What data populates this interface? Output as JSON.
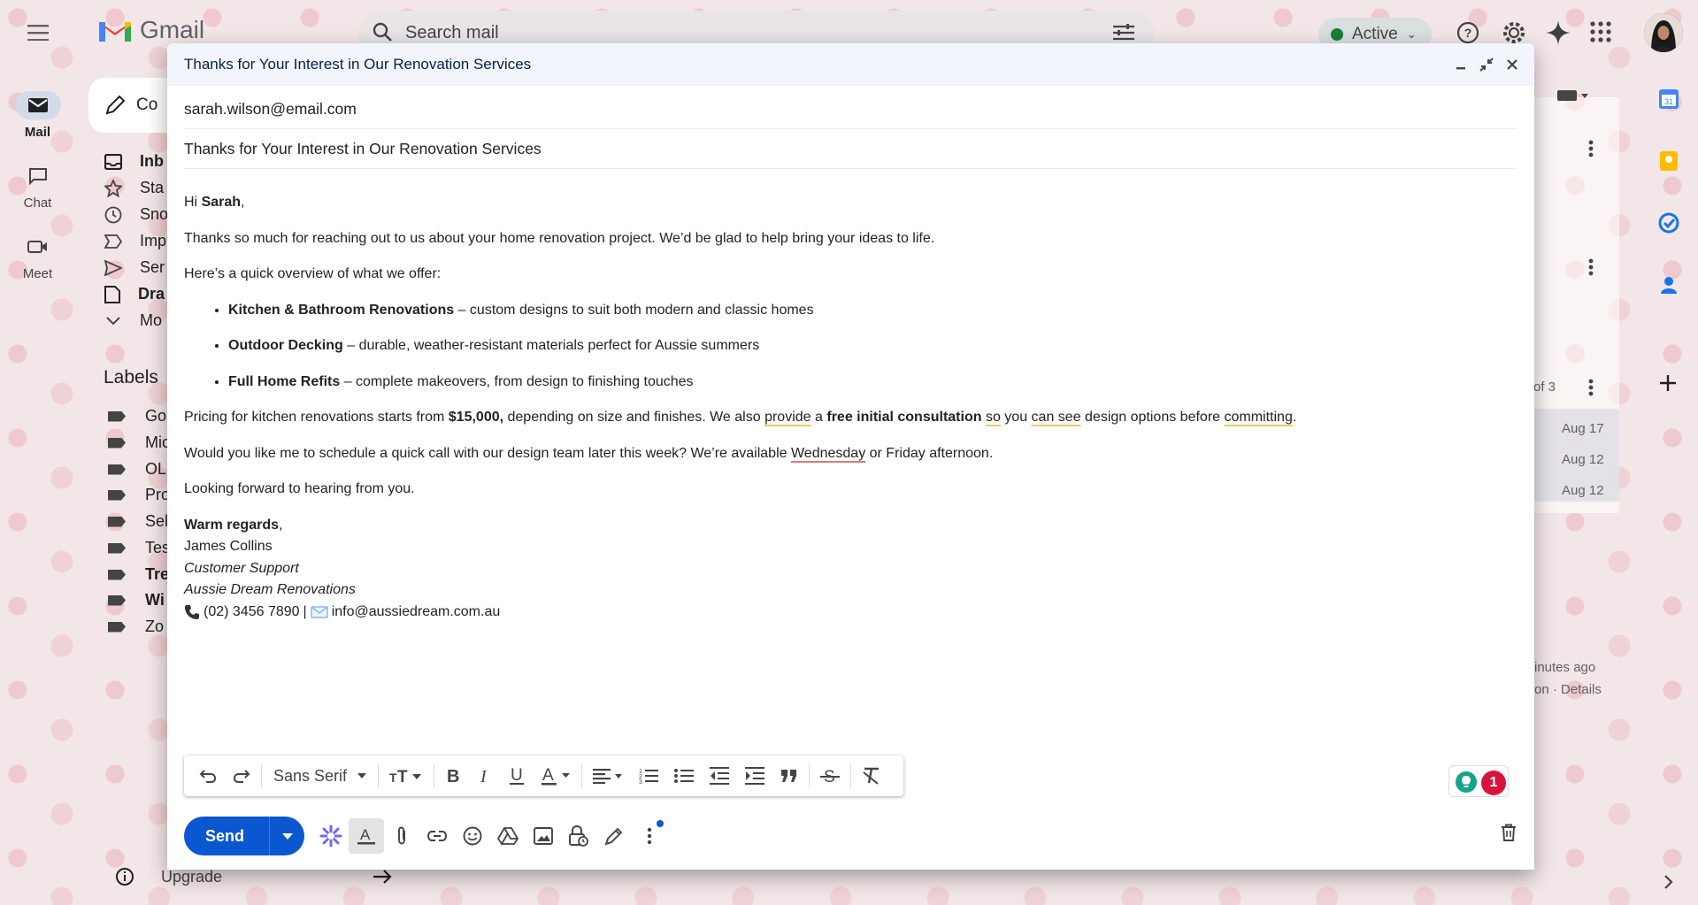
{
  "app": {
    "name": "Gmail"
  },
  "search": {
    "placeholder": "Search mail"
  },
  "status": {
    "label": "Active"
  },
  "rail": [
    {
      "label": "Mail"
    },
    {
      "label": "Chat"
    },
    {
      "label": "Meet"
    }
  ],
  "compose_button": {
    "label": "Co"
  },
  "nav": [
    {
      "label": "Inb",
      "icon": "inbox-icon",
      "bold": true
    },
    {
      "label": "Sta",
      "icon": "star-icon"
    },
    {
      "label": "Sno",
      "icon": "clock-icon"
    },
    {
      "label": "Imp",
      "icon": "important-icon"
    },
    {
      "label": "Ser",
      "icon": "send-icon"
    },
    {
      "label": "Dra",
      "icon": "draft-icon",
      "bold": true
    },
    {
      "label": "Mo",
      "icon": "chevron-down-icon"
    }
  ],
  "labels": {
    "heading": "Labels",
    "items": [
      {
        "label": "Go"
      },
      {
        "label": "Mic"
      },
      {
        "label": "OL"
      },
      {
        "label": "Pro"
      },
      {
        "label": "Sel"
      },
      {
        "label": "Tes"
      },
      {
        "label": "Tre",
        "bold": true
      },
      {
        "label": "Wi",
        "bold": true
      },
      {
        "label": "Zo"
      }
    ]
  },
  "upgrade": {
    "label": "Upgrade"
  },
  "background_list": {
    "page_info": "of 3",
    "dates": [
      "Aug 17",
      "Aug 12",
      "Aug 12"
    ],
    "activity_1": "inutes ago",
    "activity_2": "on · Details"
  },
  "compose": {
    "title": "Thanks for Your Interest in Our Renovation Services",
    "to": "sarah.wilson@email.com",
    "subject": "Thanks for Your Interest in Our Renovation Services",
    "body": {
      "greeting_hi": "Hi",
      "greeting_name": "Sarah",
      "greeting_comma": ",",
      "p1": "Thanks so much for reaching out to us about your home renovation project. We’d be glad to help bring your ideas to life.",
      "p2": "Here’s a quick overview of what we offer:",
      "bullets": [
        {
          "title": "Kitchen & Bathroom Renovations",
          "text": " – custom designs to suit both modern and classic homes"
        },
        {
          "title": "Outdoor Decking",
          "text": " – durable, weather-resistant materials perfect for Aussie summers"
        },
        {
          "title": "Full Home Refits",
          "text": " – complete makeovers, from design to finishing touches"
        }
      ],
      "pricing": {
        "a": "Pricing for kitchen renovations starts from ",
        "b": "$15,000,",
        "c": " depending on size and finishes. We also ",
        "d": "provide",
        "e": " a ",
        "f": "free initial consultation",
        "g": " ",
        "h": "so",
        "i": " you ",
        "j": "can see",
        "k": " design options before ",
        "l": "committing",
        "m": "."
      },
      "schedule": {
        "a": "Would you like me to schedule a quick call with our design team later this week? We’re available ",
        "b": "Wednesday",
        "c": " or Friday afternoon."
      },
      "closing": "Looking forward to hearing from you.",
      "signoff_bold": "Warm regards",
      "signoff_comma": ",",
      "sig_name": "James Collins",
      "sig_role": "Customer Support",
      "sig_company": "Aussie Dream Renovations",
      "sig_phone": "(02) 3456 7890",
      "sig_sep": "|",
      "sig_email": "info@aussiedream.com.au"
    },
    "format_bar": {
      "font": "Sans Serif"
    },
    "send_label": "Send",
    "grammar_count": "1"
  },
  "colors": {
    "accent": "#0b57d0",
    "header_bg": "#f2f6fc",
    "alert": "#d8143a",
    "active_green": "#188038"
  }
}
